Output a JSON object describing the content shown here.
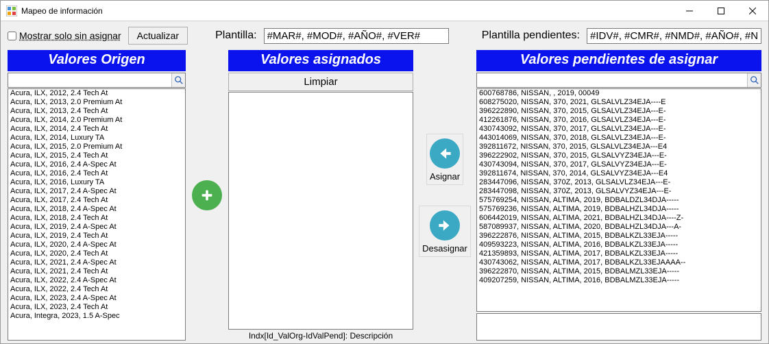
{
  "window": {
    "title": "Mapeo de información"
  },
  "toolbar": {
    "show_unassigned_label": "Mostrar solo sin asignar",
    "show_unassigned_checked": false,
    "actualizar_label": "Actualizar",
    "plantilla_label": "Plantilla:",
    "plantilla_value": "#MAR#, #MOD#, #AÑO#, #VER#",
    "plantilla_pend_label": "Plantilla pendientes:",
    "plantilla_pend_value": "#IDV#, #CMR#, #NMD#, #AÑO#, #NVR#"
  },
  "panels": {
    "origen_header": "Valores Origen",
    "asignados_header": "Valores asignados",
    "pendientes_header": "Valores pendientes de asignar",
    "limpiar_label": "Limpiar",
    "asignar_label": "Asignar",
    "desasignar_label": "Desasignar",
    "footer_label": "Indx[Id_ValOrg-IdValPend]: Descripción"
  },
  "search": {
    "origen_value": "",
    "pendientes_value": ""
  },
  "origen_items": [
    "Acura, ILX, 2012, 2.4 Tech At",
    "Acura, ILX, 2013, 2.0 Premium At",
    "Acura, ILX, 2013, 2.4 Tech At",
    "Acura, ILX, 2014, 2.0 Premium At",
    "Acura, ILX, 2014, 2.4 Tech At",
    "Acura, ILX, 2014, Luxury TA",
    "Acura, ILX, 2015, 2.0 Premium At",
    "Acura, ILX, 2015, 2.4 Tech At",
    "Acura, ILX, 2016, 2.4 A-Spec At",
    "Acura, ILX, 2016, 2.4 Tech At",
    "Acura, ILX, 2016, Luxury TA",
    "Acura, ILX, 2017, 2.4 A-Spec At",
    "Acura, ILX, 2017, 2.4 Tech At",
    "Acura, ILX, 2018, 2.4 A-Spec At",
    "Acura, ILX, 2018, 2.4 Tech At",
    "Acura, ILX, 2019, 2.4 A-Spec At",
    "Acura, ILX, 2019, 2.4 Tech At",
    "Acura, ILX, 2020, 2.4 A-Spec At",
    "Acura, ILX, 2020, 2.4 Tech At",
    "Acura, ILX, 2021, 2.4 A-Spec At",
    "Acura, ILX, 2021, 2.4 Tech At",
    "Acura, ILX, 2022, 2.4 A-Spec At",
    "Acura, ILX, 2022, 2.4 Tech At",
    "Acura, ILX, 2023, 2.4 A-Spec At",
    "Acura, ILX, 2023, 2.4 Tech At",
    "Acura, Integra, 2023, 1.5 A-Spec"
  ],
  "pendientes_items": [
    "600768786, NISSAN, , 2019, 00049",
    "608275020, NISSAN, 370, 2021, GLSALVLZ34EJA----E",
    "396222890, NISSAN, 370, 2015, GLSALVLZ34EJA---E-",
    "412261876, NISSAN, 370, 2016, GLSALVLZ34EJA---E-",
    "430743092, NISSAN, 370, 2017, GLSALVLZ34EJA---E-",
    "443014069, NISSAN, 370, 2018, GLSALVLZ34EJA---E-",
    "392811672, NISSAN, 370, 2015, GLSALVLZ34EJA---E4",
    "396222902, NISSAN, 370, 2015, GLSALVYZ34EJA---E-",
    "430743094, NISSAN, 370, 2017, GLSALVYZ34EJA---E-",
    "392811674, NISSAN, 370, 2014, GLSALVYZ34EJA---E4",
    "283447096, NISSAN, 370Z, 2013, GLSALVLZ34EJA---E-",
    "283447098, NISSAN, 370Z, 2013, GLSALVYZ34EJA---E-",
    "575769254, NISSAN, ALTIMA, 2019, BDBALDZL34DJA-----",
    "575769236, NISSAN, ALTIMA, 2019, BDBALHZL34DJA-----",
    "606442019, NISSAN, ALTIMA, 2021, BDBALHZL34DJA----Z-",
    "587089937, NISSAN, ALTIMA, 2020, BDBALHZL34DJA---A-",
    "396222876, NISSAN, ALTIMA, 2015, BDBALKZL33EJA-----",
    "409593223, NISSAN, ALTIMA, 2016, BDBALKZL33EJA-----",
    "421359893, NISSAN, ALTIMA, 2017, BDBALKZL33EJA-----",
    "430743062, NISSAN, ALTIMA, 2017, BDBALKZL33EJAAAA--",
    "396222870, NISSAN, ALTIMA, 2015, BDBALMZL33EJA-----",
    "409207259, NISSAN, ALTIMA, 2016, BDBALMZL33EJA-----"
  ]
}
